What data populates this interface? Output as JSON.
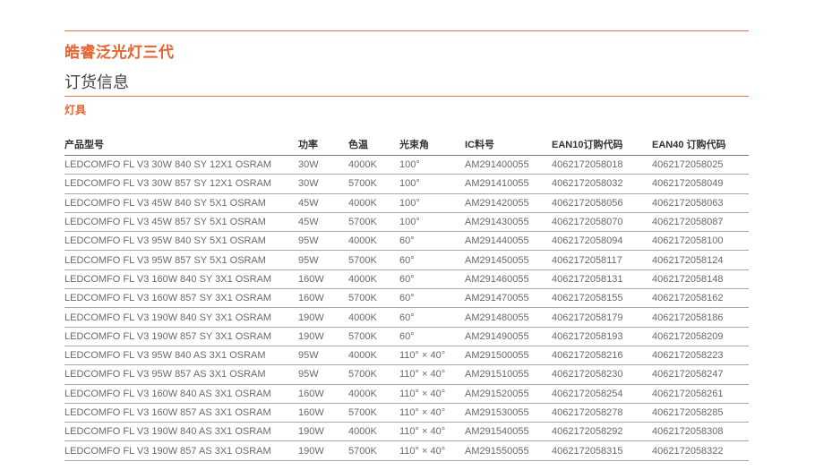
{
  "header": {
    "brand_title": "皓睿泛光灯三代",
    "section_title": "订货信息",
    "subsection_title": "灯具"
  },
  "colors": {
    "accent": "#e8632e",
    "rule": "#e8734a",
    "text": "#6a6a6a"
  },
  "table": {
    "columns": [
      "产品型号",
      "功率",
      "色温",
      "光束角",
      "IC料号",
      "EAN10订购代码",
      "EAN40 订购代码"
    ],
    "rows": [
      [
        "LEDCOMFO FL V3 30W 840 SY 12X1 OSRAM",
        "30W",
        "4000K",
        "100°",
        "AM291400055",
        "4062172058018",
        "4062172058025"
      ],
      [
        "LEDCOMFO FL V3 30W 857 SY 12X1 OSRAM",
        "30W",
        "5700K",
        "100°",
        "AM291410055",
        "4062172058032",
        "4062172058049"
      ],
      [
        "LEDCOMFO FL V3 45W 840 SY 5X1 OSRAM",
        "45W",
        "4000K",
        "100°",
        "AM291420055",
        "4062172058056",
        "4062172058063"
      ],
      [
        "LEDCOMFO FL V3 45W 857 SY 5X1 OSRAM",
        "45W",
        "5700K",
        "100°",
        "AM291430055",
        "4062172058070",
        "4062172058087"
      ],
      [
        "LEDCOMFO FL V3 95W 840 SY 5X1 OSRAM",
        "95W",
        "4000K",
        "60°",
        "AM291440055",
        "4062172058094",
        "4062172058100"
      ],
      [
        "LEDCOMFO FL V3 95W 857 SY 5X1 OSRAM",
        "95W",
        "5700K",
        "60°",
        "AM291450055",
        "4062172058117",
        "4062172058124"
      ],
      [
        "LEDCOMFO FL V3 160W 840 SY 3X1 OSRAM",
        "160W",
        "4000K",
        "60°",
        "AM291460055",
        "4062172058131",
        "4062172058148"
      ],
      [
        "LEDCOMFO FL V3 160W 857 SY 3X1 OSRAM",
        "160W",
        "5700K",
        "60°",
        "AM291470055",
        "4062172058155",
        "4062172058162"
      ],
      [
        "LEDCOMFO FL V3 190W 840 SY 3X1 OSRAM",
        "190W",
        "4000K",
        "60°",
        "AM291480055",
        "4062172058179",
        "4062172058186"
      ],
      [
        "LEDCOMFO FL V3 190W 857 SY 3X1 OSRAM",
        "190W",
        "5700K",
        "60°",
        "AM291490055",
        "4062172058193",
        "4062172058209"
      ],
      [
        "LEDCOMFO FL V3 95W 840 AS 3X1 OSRAM",
        "95W",
        "4000K",
        "110° × 40°",
        "AM291500055",
        "4062172058216",
        "4062172058223"
      ],
      [
        "LEDCOMFO FL V3 95W 857 AS 3X1  OSRAM",
        "95W",
        "5700K",
        "110° × 40°",
        "AM291510055",
        "4062172058230",
        "4062172058247"
      ],
      [
        "LEDCOMFO FL V3 160W 840 AS 3X1 OSRAM",
        "160W",
        "4000K",
        "110° × 40°",
        "AM291520055",
        "4062172058254",
        "4062172058261"
      ],
      [
        "LEDCOMFO FL V3 160W 857 AS 3X1 OSRAM",
        "160W",
        "5700K",
        "110° × 40°",
        "AM291530055",
        "4062172058278",
        "4062172058285"
      ],
      [
        "LEDCOMFO FL V3 190W 840 AS 3X1 OSRAM",
        "190W",
        "4000K",
        "110° × 40°",
        "AM291540055",
        "4062172058292",
        "4062172058308"
      ],
      [
        "LEDCOMFO FL V3 190W 857 AS 3X1 OSRAM",
        "190W",
        "5700K",
        "110° × 40°",
        "AM291550055",
        "4062172058315",
        "4062172058322"
      ]
    ]
  }
}
